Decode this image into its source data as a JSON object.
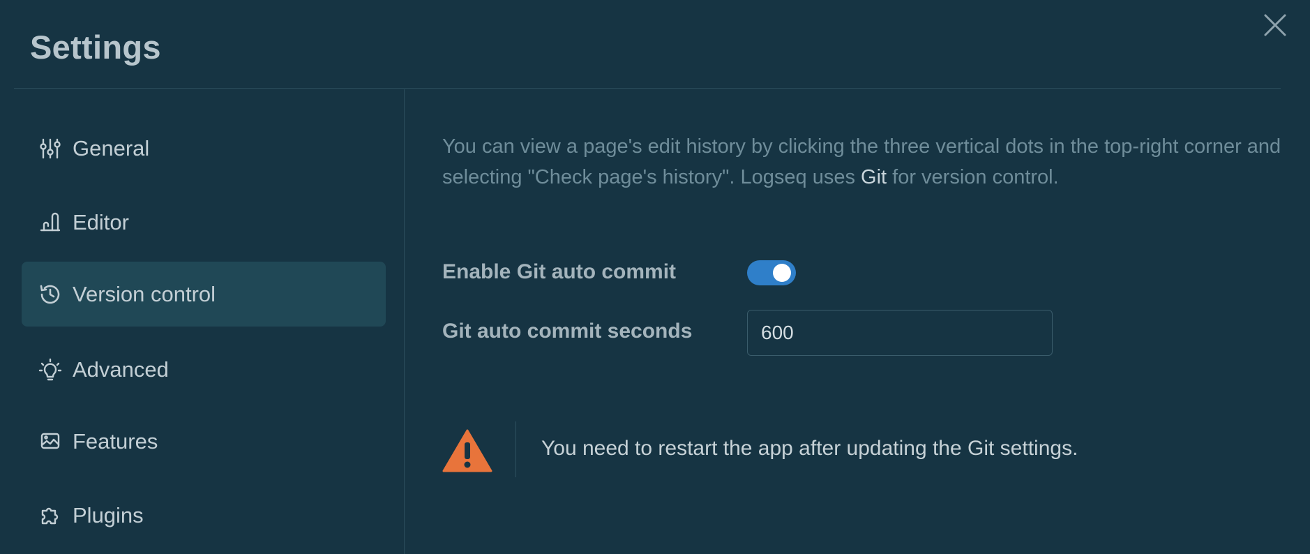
{
  "window": {
    "title": "Settings",
    "close_icon": "close-icon"
  },
  "sidebar": {
    "active_index": 2,
    "items": [
      {
        "label": "General",
        "icon": "sliders-icon"
      },
      {
        "label": "Editor",
        "icon": "editor-icon"
      },
      {
        "label": "Version control",
        "icon": "history-icon"
      },
      {
        "label": "Advanced",
        "icon": "bulb-icon"
      },
      {
        "label": "Features",
        "icon": "features-icon"
      },
      {
        "label": "Plugins",
        "icon": "puzzle-icon"
      }
    ]
  },
  "main": {
    "description_before": "You can view a page's edit history by clicking the three vertical dots in the top-right corner and selecting \"Check page's history\". Logseq uses ",
    "description_link": "Git",
    "description_after": " for version control.",
    "auto_commit": {
      "label": "Enable Git auto commit",
      "enabled": true
    },
    "auto_commit_seconds": {
      "label": "Git auto commit seconds",
      "value": "600"
    },
    "warning": {
      "icon": "warning-triangle-icon",
      "text": "You need to restart the app after updating the Git settings."
    }
  },
  "colors": {
    "background": "#163443",
    "active_item": "#204856",
    "toggle_on": "#2f7fc9",
    "warning": "#e8743b"
  }
}
